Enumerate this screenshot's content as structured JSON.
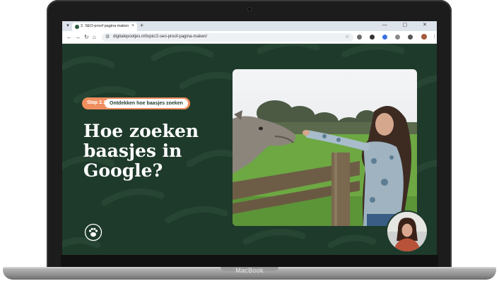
{
  "device": {
    "brand_label": "MacBook"
  },
  "browser": {
    "tab_title": "2. SEO-proof pagina maken – D",
    "url": "digitalepootjes.nl/topic/2-seo-proof-pagina-maken/",
    "new_tab_symbol": "+",
    "tab_close_symbol": "×",
    "window_controls": "— ▢ ✕"
  },
  "slide": {
    "step_label": "Stap 2.1",
    "step_title": "Ontdekken hoe baasjes zoeken",
    "headline": "Hoe zoeken baasjes in Google?",
    "colors": {
      "background": "#1e3a2b",
      "accent": "#ef8e5e",
      "text": "#ffffff"
    },
    "icons": [
      "paw-logo-icon"
    ]
  }
}
